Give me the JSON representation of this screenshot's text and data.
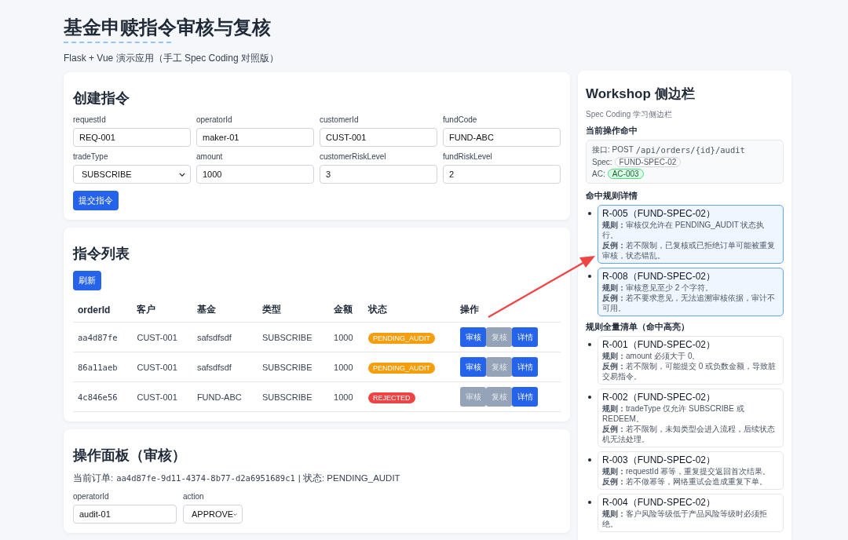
{
  "header": {
    "title": "基金申赎指令审核与复核",
    "subtitle": "Flask + Vue 演示应用（手工 Spec Coding 对照版）"
  },
  "create_form": {
    "heading": "创建指令",
    "fields": [
      {
        "kind": "text",
        "label": "requestId",
        "value": "REQ-001"
      },
      {
        "kind": "text",
        "label": "operatorId",
        "value": "maker-01"
      },
      {
        "kind": "text",
        "label": "customerId",
        "value": "CUST-001"
      },
      {
        "kind": "text",
        "label": "fundCode",
        "value": "FUND-ABC"
      },
      {
        "kind": "select",
        "label": "tradeType",
        "value": "SUBSCRIBE"
      },
      {
        "kind": "text",
        "label": "amount",
        "value": "1000"
      },
      {
        "kind": "text",
        "label": "customerRiskLevel",
        "value": "3"
      },
      {
        "kind": "text",
        "label": "fundRiskLevel",
        "value": "2"
      }
    ],
    "submit": "提交指令"
  },
  "order_list": {
    "heading": "指令列表",
    "refresh": "刷新",
    "columns": [
      "orderId",
      "客户",
      "基金",
      "类型",
      "金额",
      "状态",
      "操作"
    ],
    "rows": [
      {
        "order_id": "aa4d87fe",
        "customer": "CUST-001",
        "fund": "safsdfsdf",
        "type": "SUBSCRIBE",
        "amount": "1000",
        "status": {
          "text": "PENDING_AUDIT",
          "color": "#f59e0b"
        },
        "actions": [
          {
            "label": "审核",
            "disabled": false
          },
          {
            "label": "复核",
            "disabled": true
          },
          {
            "label": "详情",
            "disabled": false
          }
        ]
      },
      {
        "order_id": "86a11aeb",
        "customer": "CUST-001",
        "fund": "safsdfsdf",
        "type": "SUBSCRIBE",
        "amount": "1000",
        "status": {
          "text": "PENDING_AUDIT",
          "color": "#f59e0b"
        },
        "actions": [
          {
            "label": "审核",
            "disabled": false
          },
          {
            "label": "复核",
            "disabled": true
          },
          {
            "label": "详情",
            "disabled": false
          }
        ]
      },
      {
        "order_id": "4c846e56",
        "customer": "CUST-001",
        "fund": "FUND-ABC",
        "type": "SUBSCRIBE",
        "amount": "1000",
        "status": {
          "text": "REJECTED",
          "color": "#ef4444"
        },
        "actions": [
          {
            "label": "审核",
            "disabled": true
          },
          {
            "label": "复核",
            "disabled": true
          },
          {
            "label": "详情",
            "disabled": false
          }
        ]
      }
    ]
  },
  "action_panel": {
    "heading": "操作面板（审核）",
    "current_label": "当前订单:",
    "order_id": "aa4d87fe-9d11-4374-8b77-d2a6951689c1",
    "status_text": "| 状态: PENDING_AUDIT",
    "fields": [
      {
        "kind": "text",
        "label": "operatorId",
        "value": "audit-01"
      },
      {
        "kind": "select",
        "label": "action",
        "value": "APPROVE"
      }
    ]
  },
  "sidebar": {
    "title": "Workshop 侧边栏",
    "subtitle": "Spec Coding 学习侧边栏",
    "current_hit": {
      "heading": "当前操作命中",
      "endpoint_label": "接口: POST",
      "endpoint": "/api/orders/{id}/audit",
      "spec_label": "Spec:",
      "spec": "FUND-SPEC-02",
      "ac_label": "AC:",
      "ac": "AC-003"
    },
    "hit_rules": {
      "heading": "命中规则详情",
      "rules": [
        {
          "title": "R-005（FUND-SPEC-02）",
          "rule": "**规则：**审核仅允许在 PENDING_AUDIT 状态执行。",
          "counter": "**反例：**若不限制，已复核或已拒绝订单可能被重复审核，状态错乱。",
          "highlighted": true
        },
        {
          "title": "R-008（FUND-SPEC-02）",
          "rule": "**规则：**审核意见至少 2 个字符。",
          "counter": "**反例：**若不要求意见，无法追溯审核依据，审计不可用。",
          "highlighted": true
        }
      ]
    },
    "all_rules": {
      "heading": "规则全量清单（命中高亮）",
      "rules": [
        {
          "title": "R-001（FUND-SPEC-02）",
          "rule": "**规则：**amount 必须大于 0。",
          "counter": "**反例：**若不限制，可能提交 0 或负数金额，导致脏交易指令。",
          "highlighted": false
        },
        {
          "title": "R-002（FUND-SPEC-02）",
          "rule": "**规则：**tradeType 仅允许 SUBSCRIBE 或 REDEEM。",
          "counter": "**反例：**若不限制，未知类型会进入流程，后续状态机无法处理。",
          "highlighted": false
        },
        {
          "title": "R-003（FUND-SPEC-02）",
          "rule": "**规则：**requestId 幂等，重复提交返回首次结果。",
          "counter": "**反例：**若不做幂等，网络重试会造成重复下单。",
          "highlighted": false
        },
        {
          "title": "R-004（FUND-SPEC-02）",
          "rule": "**规则：**客户风险等级低于产品风险等级时必须拒绝。",
          "highlighted": false
        }
      ]
    }
  }
}
